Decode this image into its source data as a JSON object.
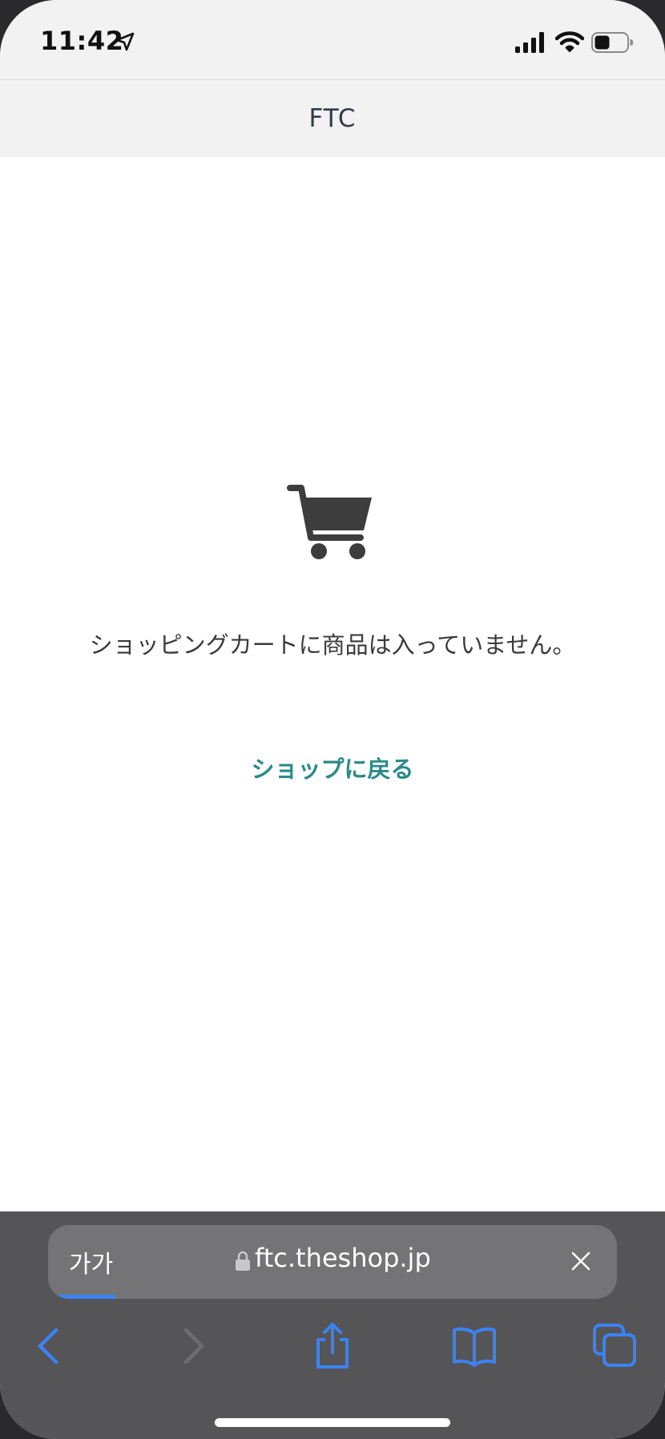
{
  "status_bar": {
    "time": "11:42",
    "location_icon": "location-arrow-icon",
    "signal_icon": "cellular-signal-icon",
    "wifi_icon": "wifi-icon",
    "battery_icon": "battery-icon"
  },
  "header": {
    "title": "FTC"
  },
  "cart": {
    "icon": "shopping-cart-icon",
    "empty_message": "ショッピングカートに商品は入っていません。",
    "back_link_label": "ショップに戻る"
  },
  "safari": {
    "text_size_label": "가가",
    "url": "ftc.theshop.jp",
    "load_progress": 0.12,
    "toolbar_icons": [
      "back-icon",
      "forward-icon",
      "share-icon",
      "bookmarks-icon",
      "tabs-icon"
    ]
  },
  "colors": {
    "accent_teal": "#2a8a8a",
    "safari_blue": "#3b82f6",
    "header_bg": "#f2f2f2",
    "toolbar_bg": "#555557"
  }
}
